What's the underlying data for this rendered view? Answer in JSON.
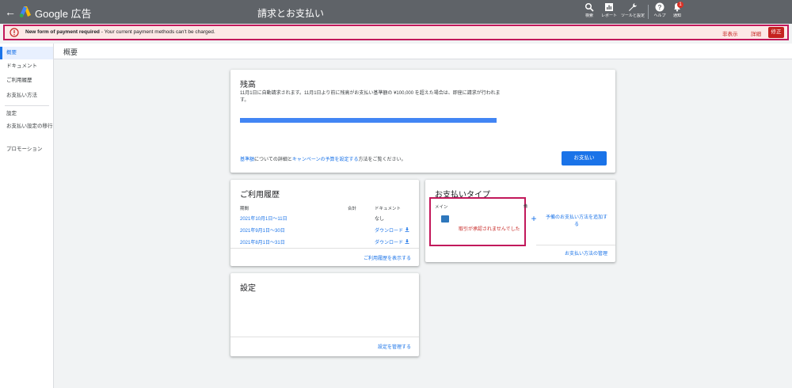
{
  "topbar": {
    "back_label": "←",
    "brand": "Google 広告",
    "title": "請求とお支払い",
    "tools": [
      {
        "icon": "search-icon",
        "label": "検索"
      },
      {
        "icon": "report-icon",
        "label": "レポート"
      },
      {
        "icon": "wrench-icon",
        "label": "ツールと設定"
      },
      {
        "icon": "help-icon",
        "label": "ヘルプ"
      },
      {
        "icon": "bell-icon",
        "label": "通知",
        "badge": "1"
      }
    ]
  },
  "alert": {
    "bold": "New form of payment required",
    "text": " - Your current payment methods can't be charged.",
    "hide": "非表示",
    "details": "詳細",
    "fix": "修正"
  },
  "sidebar": {
    "items": [
      "概要",
      "ドキュメント",
      "ご利用履歴",
      "お支払い方法",
      "設定",
      "お支払い設定の移行",
      "プロモーション"
    ]
  },
  "page": {
    "title": "概要"
  },
  "balance": {
    "title": "残高",
    "description": "11月1日に自動請求されます。11月1日より前に残高がお支払い基準額の ¥100,000 を超えた場合は、即座に請求が行われます。",
    "progress": 0.0,
    "footer_link1": "基準額",
    "footer_text1": "についての詳細と",
    "footer_link2": "キャンペーンの予算を設定する",
    "footer_text2": "方法をご覧ください。",
    "pay_button": "お支払い"
  },
  "history": {
    "title": "ご利用履歴",
    "headers": {
      "period": "期間",
      "total": "合計",
      "document": "ドキュメント"
    },
    "rows": [
      {
        "period": "2021年10月1日～11日",
        "document": "なし"
      },
      {
        "period": "2021年9月1日～30日",
        "document": "ダウンロード"
      },
      {
        "period": "2021年8月1日～31日",
        "document": "ダウンロード"
      }
    ],
    "footer": "ご利用履歴を表示する"
  },
  "settings": {
    "title": "設定",
    "footer": "設定を管理する"
  },
  "payment_type": {
    "title": "お支払いタイプ",
    "main_label": "メイン",
    "side_label": "備",
    "error": "取引が承認されませんでした",
    "add_label": "予備のお支払い方法を追加する",
    "footer": "お支払い方法の管理"
  },
  "colors": {
    "topbar": "#5f6368",
    "accent": "#1a73e8",
    "error": "#c5221f",
    "highlight": "#c2185b"
  }
}
